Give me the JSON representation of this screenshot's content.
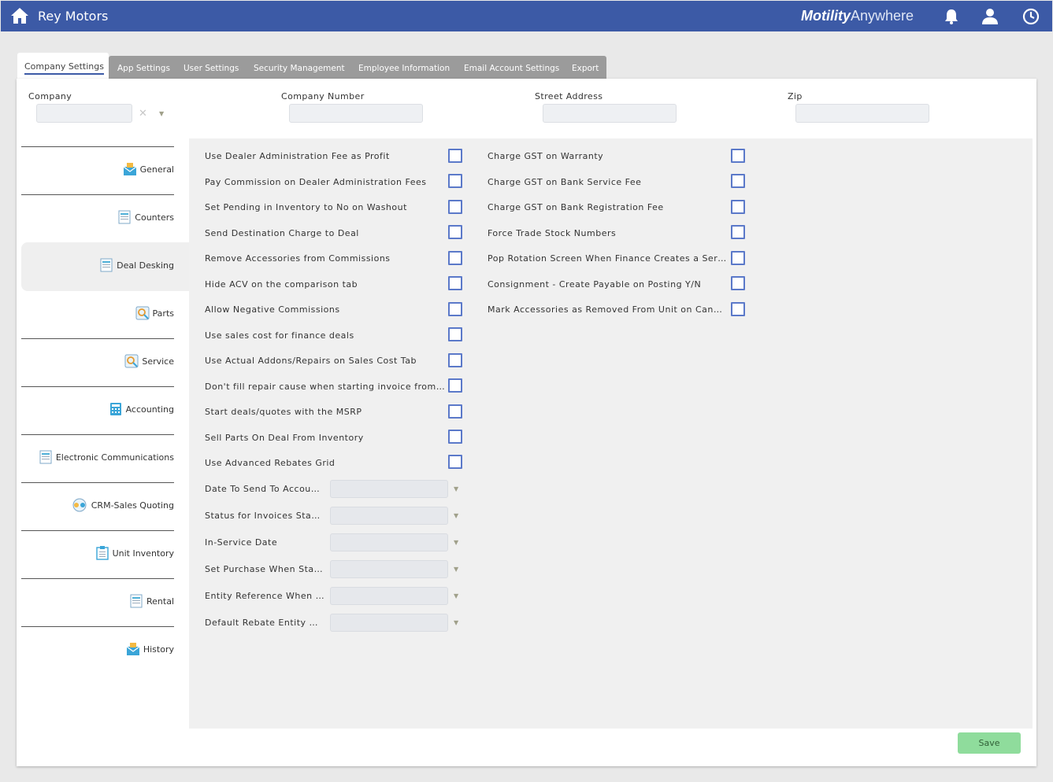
{
  "header": {
    "app_title": "Rey Motors",
    "brand_bold": "Motility",
    "brand_light": "Anywhere",
    "icons": [
      "home-icon",
      "bell-icon",
      "user-icon",
      "clock-icon"
    ],
    "color": "#3c5aa6"
  },
  "tabs": [
    {
      "label": "Company Settings",
      "active": true
    },
    {
      "label": "App Settings"
    },
    {
      "label": "User Settings"
    },
    {
      "label": "Security Management"
    },
    {
      "label": "Employee Information"
    },
    {
      "label": "Email Account Settings"
    },
    {
      "label": "Export"
    }
  ],
  "filters": {
    "company_label": "Company",
    "company_clear": "✕",
    "company_caret": "▼",
    "company_number_label": "Company Number",
    "street_address_label": "Street Address",
    "zip_label": "Zip"
  },
  "sidebar": {
    "items": [
      {
        "label": "General",
        "icon": "envelope-icon"
      },
      {
        "label": "Counters",
        "icon": "document-icon"
      },
      {
        "label": "Deal Desking",
        "icon": "document-icon",
        "active": true
      },
      {
        "label": "Parts",
        "icon": "parts-icon"
      },
      {
        "label": "Service",
        "icon": "service-icon"
      },
      {
        "label": "Accounting",
        "icon": "calculator-icon"
      },
      {
        "label": "Electronic Communications",
        "icon": "document-icon"
      },
      {
        "label": "CRM-Sales Quoting",
        "icon": "crm-icon"
      },
      {
        "label": "Unit Inventory",
        "icon": "clipboard-icon"
      },
      {
        "label": "Rental",
        "icon": "document-icon"
      },
      {
        "label": "History",
        "icon": "envelope-icon"
      }
    ]
  },
  "options_left": [
    "Use Dealer Administration Fee as Profit",
    "Pay Commission on Dealer Administration Fees",
    "Set Pending in Inventory to No on Washout",
    "Send Destination Charge to Deal",
    "Remove Accessories from Commissions",
    "Hide ACV on the comparison tab",
    "Allow Negative Commissions",
    "Use sales cost for finance deals",
    "Use Actual Addons/Repairs on Sales Cost Tab",
    "Don't fill repair cause when starting invoice from deal",
    "Start deals/quotes with the MSRP",
    "Sell Parts On Deal From Inventory",
    "Use Advanced Rebates Grid"
  ],
  "options_right": [
    "Charge GST on Warranty",
    "Charge GST on Bank Service Fee",
    "Charge GST on Bank Registration Fee",
    "Force Trade Stock Numbers",
    "Pop Rotation Screen When Finance Creates a Service Order",
    "Consignment - Create Payable on Posting Y/N",
    "Mark Accessories as Removed From Unit on Cancel"
  ],
  "dropdowns": [
    {
      "label": "Date To Send To Accounting",
      "display": "Date To Send To Accou…",
      "value": ""
    },
    {
      "label": "Status for Invoices Started",
      "display": "Status for Invoices Sta…",
      "value": ""
    },
    {
      "label": "In-Service Date",
      "display": "In-Service Date",
      "value": ""
    },
    {
      "label": "Set Purchase When Started",
      "display": "Set Purchase When Sta…",
      "value": ""
    },
    {
      "label": "Entity Reference When",
      "display": "Entity Reference When …",
      "value": ""
    },
    {
      "label": "Default Rebate Entity",
      "display": "Default Rebate Entity …",
      "value": ""
    }
  ],
  "caret": "▼",
  "save_label": "Save",
  "save_color": "#8fdc9c"
}
